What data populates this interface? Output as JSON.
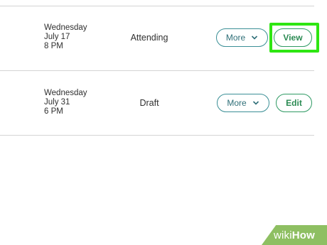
{
  "events": [
    {
      "date": {
        "weekday": "Wednesday",
        "month_day": "July 17",
        "time": "8 PM"
      },
      "status": "Attending",
      "more_label": "More",
      "action_label": "View"
    },
    {
      "date": {
        "weekday": "Wednesday",
        "month_day": "July 31",
        "time": "6 PM"
      },
      "status": "Draft",
      "more_label": "More",
      "action_label": "Edit"
    }
  ],
  "watermark": {
    "part1": "wiki",
    "part2": "How"
  },
  "colors": {
    "accent_teal": "#3a8f96",
    "action_green": "#2f9a64",
    "highlight": "#2ee612",
    "watermark_bg": "#8ebf62"
  }
}
